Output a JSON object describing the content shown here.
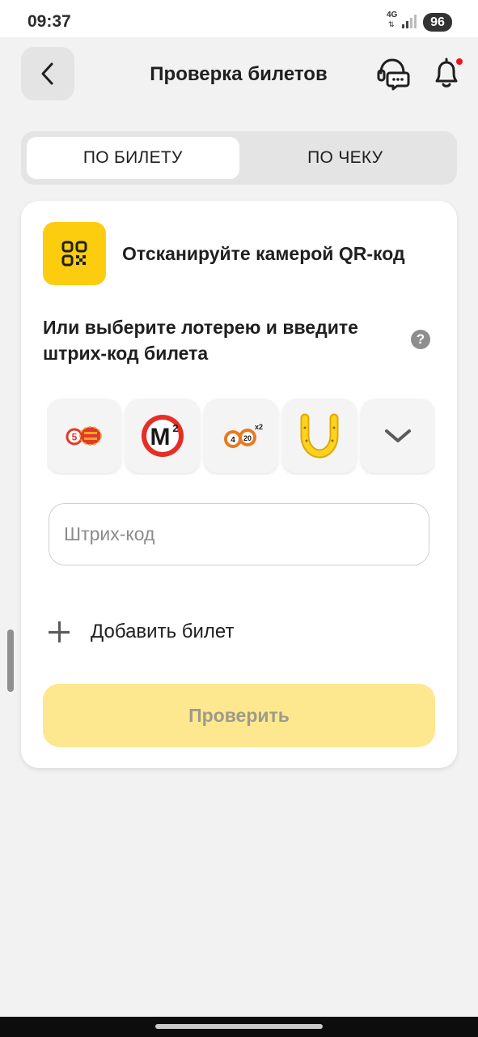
{
  "status_bar": {
    "time": "09:37",
    "network": "4G",
    "battery": "96"
  },
  "header": {
    "title": "Проверка билетов",
    "back_icon": "chevron-left-icon",
    "support_icon": "support-chat-icon",
    "notifications_icon": "bell-icon",
    "notification_dot_color": "#f0141e"
  },
  "tabs": [
    {
      "label": "ПО БИЛЕТУ",
      "active": true
    },
    {
      "label": "ПО ЧЕКУ",
      "active": false
    }
  ],
  "scan": {
    "text": "Отсканируйте камерой QR-код",
    "icon": "qr-code-icon"
  },
  "choose": {
    "text": "Или выберите лотерею и введите штрих-код билета",
    "help_icon": "?"
  },
  "lotteries": [
    {
      "icon": "lottery-5x36-icon"
    },
    {
      "icon": "lottery-m2-icon",
      "text": "M"
    },
    {
      "icon": "lottery-4x20-icon"
    },
    {
      "icon": "lottery-horseshoe-icon"
    },
    {
      "icon": "chevron-down-icon"
    }
  ],
  "barcode": {
    "placeholder": "Штрих-код",
    "value": ""
  },
  "add_ticket": {
    "label": "Добавить билет"
  },
  "submit": {
    "label": "Проверить"
  },
  "colors": {
    "accent": "#fbcd0e",
    "button_disabled": "#fde88f",
    "background": "#f2f2f2"
  }
}
